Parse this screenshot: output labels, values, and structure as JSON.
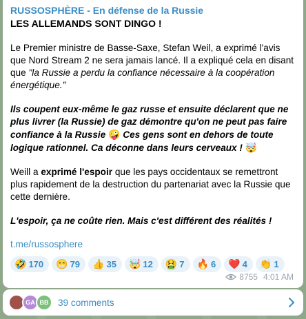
{
  "post": {
    "channel_name": "RUSSOSPHÈRE - En défense de la Russie",
    "headline": "LES ALLEMANDS SONT DINGO !",
    "p1_text": "Le Premier ministre de Basse-Saxe, Stefan Weil, a exprimé l'avis que Nord Stream 2 ne sera jamais lancé. Il a expliqué cela en disant que ",
    "p1_quote": "\"la Russie a perdu la confiance nécessaire à la coopération énergétique.\"",
    "p2_a": "Ils coupent eux-même le gaz russe et ensuite déclarent que ne plus livrer (la Russie) de gaz démontre qu'on ne peut pas faire confiance à la Russie ",
    "p2_emoji1": "🤪",
    "p2_b": " Ces gens sont en dehors de toute logique rationnel. Ca déconne dans leurs cerveaux ! ",
    "p2_emoji2": "🤯",
    "p3_a": "Weill a ",
    "p3_bold": "exprimé l'espoir",
    "p3_b": " que les pays occidentaux se remettront plus rapidement de la destruction du partenariat avec la Russie que cette dernière.",
    "p4": "L'espoir, ça ne coûte rien. Mais c'est différent des réalités !",
    "link": "t.me/russosphere"
  },
  "reactions": [
    {
      "emoji": "🤣",
      "count": "170"
    },
    {
      "emoji": "😁",
      "count": "79"
    },
    {
      "emoji": "👍",
      "count": "35"
    },
    {
      "emoji": "🤯",
      "count": "12"
    },
    {
      "emoji": "🤮",
      "count": "7"
    },
    {
      "emoji": "🔥",
      "count": "6"
    },
    {
      "emoji": "❤️",
      "count": "4"
    },
    {
      "emoji": "👏",
      "count": "1"
    }
  ],
  "meta": {
    "views": "8755",
    "time": "4:01 AM"
  },
  "comments": {
    "avatars": [
      {
        "initials": "",
        "color": "#a0524a"
      },
      {
        "initials": "GA",
        "color": "#b58ad6"
      },
      {
        "initials": "BB",
        "color": "#7cc07a"
      }
    ],
    "label": "39 comments"
  }
}
